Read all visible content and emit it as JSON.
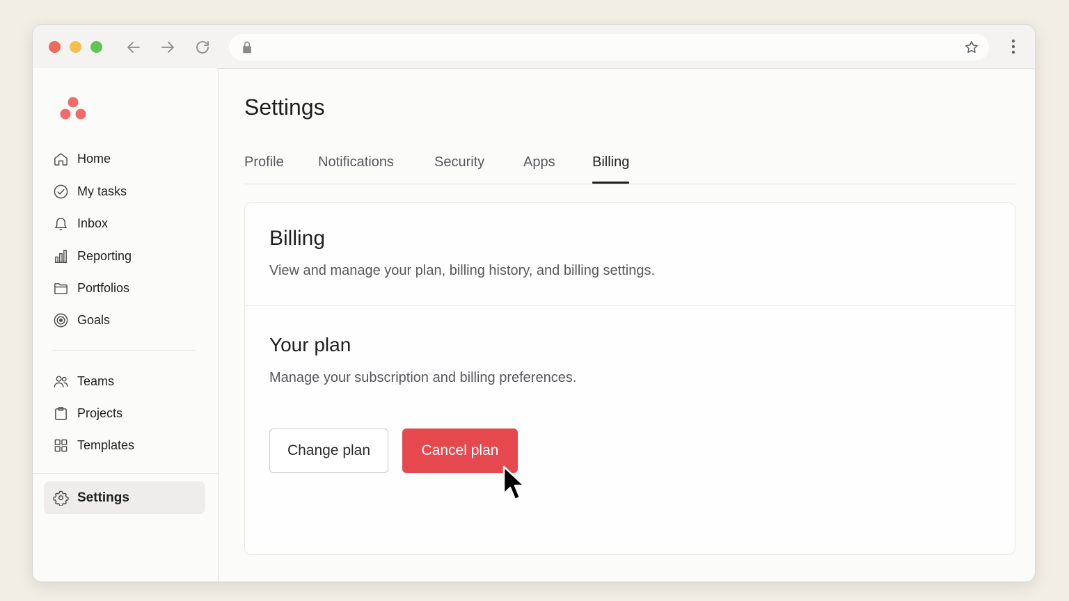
{
  "colors": {
    "close": "#ec6a5e",
    "minimize": "#f4bf4f",
    "maximize": "#61c554",
    "brand": "#f06a6a",
    "danger": "#e5484d"
  },
  "browser": {
    "url_value": "",
    "icons": [
      "back-arrow-icon",
      "forward-arrow-icon",
      "reload-icon",
      "lock-icon",
      "star-icon",
      "kebab-menu-icon"
    ]
  },
  "sidebar": {
    "logo_icon": "asana-logo-icon",
    "items": [
      {
        "label": "Home",
        "icon": "home-icon"
      },
      {
        "label": "My tasks",
        "icon": "check-circle-icon"
      },
      {
        "label": "Inbox",
        "icon": "bell-icon"
      },
      {
        "label": "Reporting",
        "icon": "bar-chart-icon"
      },
      {
        "label": "Portfolios",
        "icon": "folder-icon"
      },
      {
        "label": "Goals",
        "icon": "target-icon"
      }
    ],
    "team_items": [
      {
        "label": "Teams",
        "icon": "people-icon"
      },
      {
        "label": "Projects",
        "icon": "clipboard-icon"
      },
      {
        "label": "Templates",
        "icon": "grid-icon"
      }
    ],
    "settings": {
      "label": "Settings",
      "icon": "gear-icon",
      "active": true
    }
  },
  "main": {
    "title": "Settings",
    "tabs": [
      {
        "label": "Profile"
      },
      {
        "label": "Notifications"
      },
      {
        "label": "Security"
      },
      {
        "label": "Apps"
      },
      {
        "label": "Billing",
        "active": true
      }
    ],
    "billing": {
      "title": "Billing",
      "description": "View and manage your plan, billing history, and billing settings."
    },
    "plan": {
      "title": "Your plan",
      "description": "Manage your subscription and billing preferences.",
      "change_label": "Change plan",
      "cancel_label": "Cancel plan"
    }
  },
  "cursor_icon": "mouse-pointer-icon"
}
